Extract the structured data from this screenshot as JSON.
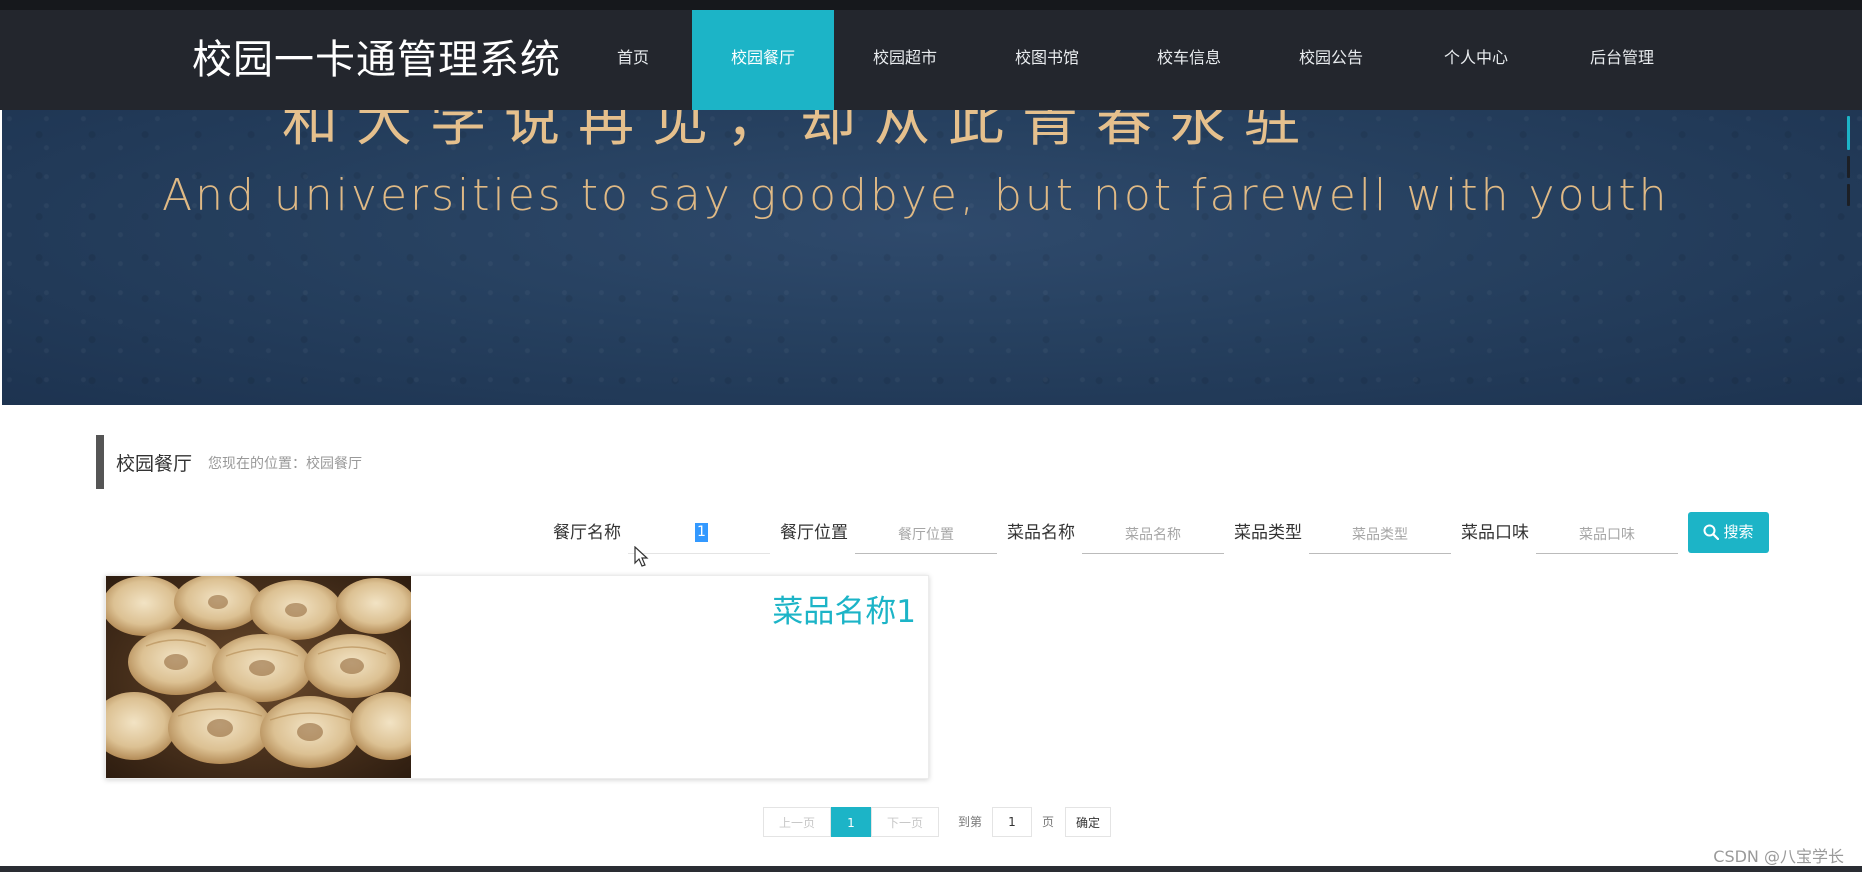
{
  "app": {
    "title": "校园一卡通管理系统"
  },
  "nav": {
    "items": [
      {
        "label": "首页"
      },
      {
        "label": "校园餐厅"
      },
      {
        "label": "校园超市"
      },
      {
        "label": "校图书馆"
      },
      {
        "label": "校车信息"
      },
      {
        "label": "校园公告"
      },
      {
        "label": "个人中心"
      },
      {
        "label": "后台管理"
      }
    ],
    "active_index": 1
  },
  "banner": {
    "headline_cn": "和大学说再见，却从此青春永驻",
    "headline_en": "And universities to say goodbye, but not farewell with youth"
  },
  "page": {
    "title": "校园餐厅",
    "breadcrumb": "您现在的位置：校园餐厅"
  },
  "search": {
    "fields": [
      {
        "label": "餐厅名称",
        "value": "1",
        "placeholder": ""
      },
      {
        "label": "餐厅位置",
        "value": "",
        "placeholder": "餐厅位置"
      },
      {
        "label": "菜品名称",
        "value": "",
        "placeholder": "菜品名称"
      },
      {
        "label": "菜品类型",
        "value": "",
        "placeholder": "菜品类型"
      },
      {
        "label": "菜品口味",
        "value": "",
        "placeholder": "菜品口味"
      }
    ],
    "button_label": "搜索"
  },
  "dishes": [
    {
      "name": "菜品名称1"
    }
  ],
  "pagination": {
    "prev_label": "上一页",
    "current_page": "1",
    "next_label": "下一页",
    "goto_prefix": "到第",
    "goto_value": "1",
    "goto_suffix": "页",
    "confirm_label": "确定"
  },
  "watermark": "CSDN @八宝学长",
  "colors": {
    "accent": "#1cb4c7",
    "navbar": "#23262d",
    "banner_text": "#e5c08d"
  }
}
